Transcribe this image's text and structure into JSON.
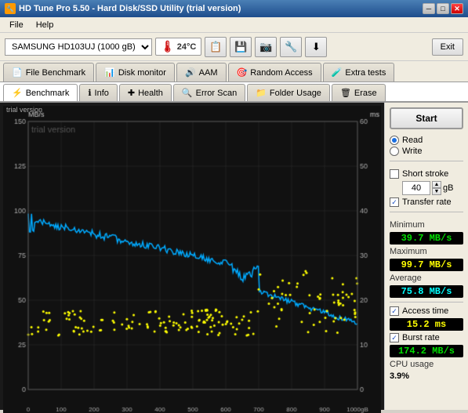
{
  "titleBar": {
    "title": "HD Tune Pro 5.50 - Hard Disk/SSD Utility (trial version)",
    "icon": "💾"
  },
  "menuBar": {
    "items": [
      "File",
      "Help"
    ]
  },
  "toolbar": {
    "driveLabel": "SAMSUNG HD103UJ (1000 gB)",
    "temperature": "24°C",
    "exitLabel": "Exit"
  },
  "tabsTop": [
    {
      "label": "File Benchmark",
      "icon": "📄",
      "active": false
    },
    {
      "label": "Disk monitor",
      "icon": "📊",
      "active": false
    },
    {
      "label": "AAM",
      "icon": "🔊",
      "active": false
    },
    {
      "label": "Random Access",
      "icon": "🎯",
      "active": false
    },
    {
      "label": "Extra tests",
      "icon": "🧪",
      "active": false
    }
  ],
  "tabsBottom": [
    {
      "label": "Benchmark",
      "icon": "⚡",
      "active": true
    },
    {
      "label": "Info",
      "icon": "ℹ️",
      "active": false
    },
    {
      "label": "Health",
      "icon": "➕",
      "active": false
    },
    {
      "label": "Error Scan",
      "icon": "🔍",
      "active": false
    },
    {
      "label": "Folder Usage",
      "icon": "📁",
      "active": false
    },
    {
      "label": "Erase",
      "icon": "🗑️",
      "active": false
    }
  ],
  "chart": {
    "watermark": "trial version",
    "leftAxisLabel": "MB/s",
    "rightAxisLabel": "ms",
    "leftMax": 150,
    "rightMax": 60,
    "xLabels": [
      "0",
      "100",
      "200",
      "300",
      "400",
      "500",
      "600",
      "700",
      "800",
      "900",
      "1000gB"
    ]
  },
  "rightPanel": {
    "startLabel": "Start",
    "readLabel": "Read",
    "writeLabel": "Write",
    "shortStrokeLabel": "Short stroke",
    "transferRateLabel": "Transfer rate",
    "shortStrokeValue": "40",
    "shortStrokeUnit": "gB",
    "stats": {
      "minimum": {
        "label": "Minimum",
        "value": "39.7 MB/s"
      },
      "maximum": {
        "label": "Maximum",
        "value": "99.7 MB/s"
      },
      "average": {
        "label": "Average",
        "value": "75.8 MB/s"
      },
      "accessTime": {
        "label": "Access time",
        "value": "15.2 ms"
      },
      "burstRate": {
        "label": "Burst rate",
        "value": "174.2 MB/s"
      },
      "cpuUsage": {
        "label": "CPU usage",
        "value": "3.9%"
      }
    }
  }
}
